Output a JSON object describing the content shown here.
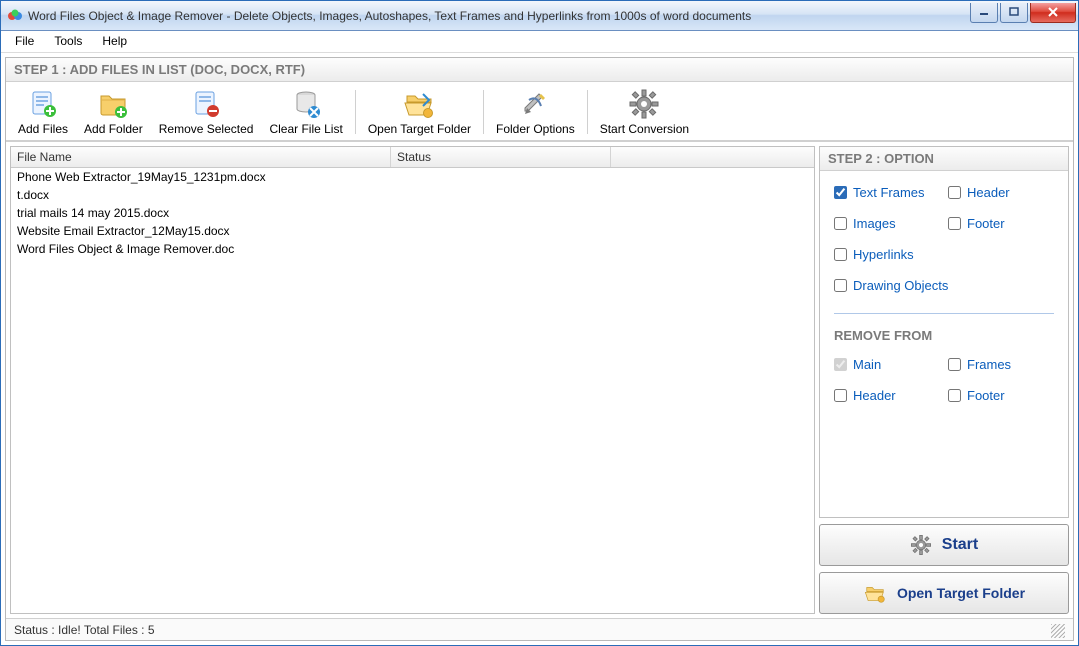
{
  "window": {
    "title": "Word Files Object & Image Remover - Delete Objects, Images, Autoshapes, Text Frames and Hyperlinks from 1000s of word documents"
  },
  "menu": {
    "file": "File",
    "tools": "Tools",
    "help": "Help"
  },
  "step1": {
    "header": "STEP 1 : ADD FILES IN LIST (DOC, DOCX, RTF)"
  },
  "toolbar": {
    "add_files": "Add Files",
    "add_folder": "Add Folder",
    "remove_selected": "Remove Selected",
    "clear_list": "Clear File List",
    "open_target": "Open Target Folder",
    "folder_options": "Folder Options",
    "start_conversion": "Start Conversion"
  },
  "grid": {
    "col_filename": "File Name",
    "col_status": "Status",
    "rows": [
      {
        "name": "Phone Web Extractor_19May15_1231pm.docx",
        "status": ""
      },
      {
        "name": "t.docx",
        "status": ""
      },
      {
        "name": "trial mails 14 may 2015.docx",
        "status": ""
      },
      {
        "name": "Website Email Extractor_12May15.docx",
        "status": ""
      },
      {
        "name": "Word Files Object & Image Remover.doc",
        "status": ""
      }
    ]
  },
  "step2": {
    "header": "STEP 2 : OPTION",
    "options": {
      "text_frames": "Text Frames",
      "header": "Header",
      "images": "Images",
      "footer": "Footer",
      "hyperlinks": "Hyperlinks",
      "drawing_objects": "Drawing Objects"
    },
    "remove_from_label": "REMOVE FROM",
    "remove_from": {
      "main": "Main",
      "frames": "Frames",
      "header": "Header",
      "footer": "Footer"
    }
  },
  "buttons": {
    "start": "Start",
    "open_target_folder": "Open Target Folder"
  },
  "status": {
    "text": "Status  :  Idle!  Total Files : 5"
  }
}
